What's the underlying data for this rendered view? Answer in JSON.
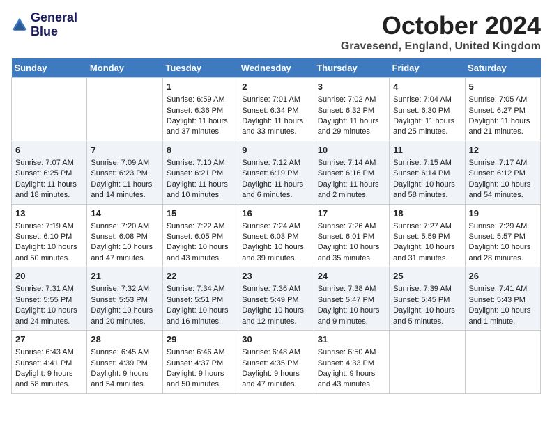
{
  "header": {
    "logo_line1": "General",
    "logo_line2": "Blue",
    "month": "October 2024",
    "location": "Gravesend, England, United Kingdom"
  },
  "days_of_week": [
    "Sunday",
    "Monday",
    "Tuesday",
    "Wednesday",
    "Thursday",
    "Friday",
    "Saturday"
  ],
  "weeks": [
    [
      {
        "day": "",
        "content": ""
      },
      {
        "day": "",
        "content": ""
      },
      {
        "day": "1",
        "content": "Sunrise: 6:59 AM\nSunset: 6:36 PM\nDaylight: 11 hours and 37 minutes."
      },
      {
        "day": "2",
        "content": "Sunrise: 7:01 AM\nSunset: 6:34 PM\nDaylight: 11 hours and 33 minutes."
      },
      {
        "day": "3",
        "content": "Sunrise: 7:02 AM\nSunset: 6:32 PM\nDaylight: 11 hours and 29 minutes."
      },
      {
        "day": "4",
        "content": "Sunrise: 7:04 AM\nSunset: 6:30 PM\nDaylight: 11 hours and 25 minutes."
      },
      {
        "day": "5",
        "content": "Sunrise: 7:05 AM\nSunset: 6:27 PM\nDaylight: 11 hours and 21 minutes."
      }
    ],
    [
      {
        "day": "6",
        "content": "Sunrise: 7:07 AM\nSunset: 6:25 PM\nDaylight: 11 hours and 18 minutes."
      },
      {
        "day": "7",
        "content": "Sunrise: 7:09 AM\nSunset: 6:23 PM\nDaylight: 11 hours and 14 minutes."
      },
      {
        "day": "8",
        "content": "Sunrise: 7:10 AM\nSunset: 6:21 PM\nDaylight: 11 hours and 10 minutes."
      },
      {
        "day": "9",
        "content": "Sunrise: 7:12 AM\nSunset: 6:19 PM\nDaylight: 11 hours and 6 minutes."
      },
      {
        "day": "10",
        "content": "Sunrise: 7:14 AM\nSunset: 6:16 PM\nDaylight: 11 hours and 2 minutes."
      },
      {
        "day": "11",
        "content": "Sunrise: 7:15 AM\nSunset: 6:14 PM\nDaylight: 10 hours and 58 minutes."
      },
      {
        "day": "12",
        "content": "Sunrise: 7:17 AM\nSunset: 6:12 PM\nDaylight: 10 hours and 54 minutes."
      }
    ],
    [
      {
        "day": "13",
        "content": "Sunrise: 7:19 AM\nSunset: 6:10 PM\nDaylight: 10 hours and 50 minutes."
      },
      {
        "day": "14",
        "content": "Sunrise: 7:20 AM\nSunset: 6:08 PM\nDaylight: 10 hours and 47 minutes."
      },
      {
        "day": "15",
        "content": "Sunrise: 7:22 AM\nSunset: 6:05 PM\nDaylight: 10 hours and 43 minutes."
      },
      {
        "day": "16",
        "content": "Sunrise: 7:24 AM\nSunset: 6:03 PM\nDaylight: 10 hours and 39 minutes."
      },
      {
        "day": "17",
        "content": "Sunrise: 7:26 AM\nSunset: 6:01 PM\nDaylight: 10 hours and 35 minutes."
      },
      {
        "day": "18",
        "content": "Sunrise: 7:27 AM\nSunset: 5:59 PM\nDaylight: 10 hours and 31 minutes."
      },
      {
        "day": "19",
        "content": "Sunrise: 7:29 AM\nSunset: 5:57 PM\nDaylight: 10 hours and 28 minutes."
      }
    ],
    [
      {
        "day": "20",
        "content": "Sunrise: 7:31 AM\nSunset: 5:55 PM\nDaylight: 10 hours and 24 minutes."
      },
      {
        "day": "21",
        "content": "Sunrise: 7:32 AM\nSunset: 5:53 PM\nDaylight: 10 hours and 20 minutes."
      },
      {
        "day": "22",
        "content": "Sunrise: 7:34 AM\nSunset: 5:51 PM\nDaylight: 10 hours and 16 minutes."
      },
      {
        "day": "23",
        "content": "Sunrise: 7:36 AM\nSunset: 5:49 PM\nDaylight: 10 hours and 12 minutes."
      },
      {
        "day": "24",
        "content": "Sunrise: 7:38 AM\nSunset: 5:47 PM\nDaylight: 10 hours and 9 minutes."
      },
      {
        "day": "25",
        "content": "Sunrise: 7:39 AM\nSunset: 5:45 PM\nDaylight: 10 hours and 5 minutes."
      },
      {
        "day": "26",
        "content": "Sunrise: 7:41 AM\nSunset: 5:43 PM\nDaylight: 10 hours and 1 minute."
      }
    ],
    [
      {
        "day": "27",
        "content": "Sunrise: 6:43 AM\nSunset: 4:41 PM\nDaylight: 9 hours and 58 minutes."
      },
      {
        "day": "28",
        "content": "Sunrise: 6:45 AM\nSunset: 4:39 PM\nDaylight: 9 hours and 54 minutes."
      },
      {
        "day": "29",
        "content": "Sunrise: 6:46 AM\nSunset: 4:37 PM\nDaylight: 9 hours and 50 minutes."
      },
      {
        "day": "30",
        "content": "Sunrise: 6:48 AM\nSunset: 4:35 PM\nDaylight: 9 hours and 47 minutes."
      },
      {
        "day": "31",
        "content": "Sunrise: 6:50 AM\nSunset: 4:33 PM\nDaylight: 9 hours and 43 minutes."
      },
      {
        "day": "",
        "content": ""
      },
      {
        "day": "",
        "content": ""
      }
    ]
  ]
}
